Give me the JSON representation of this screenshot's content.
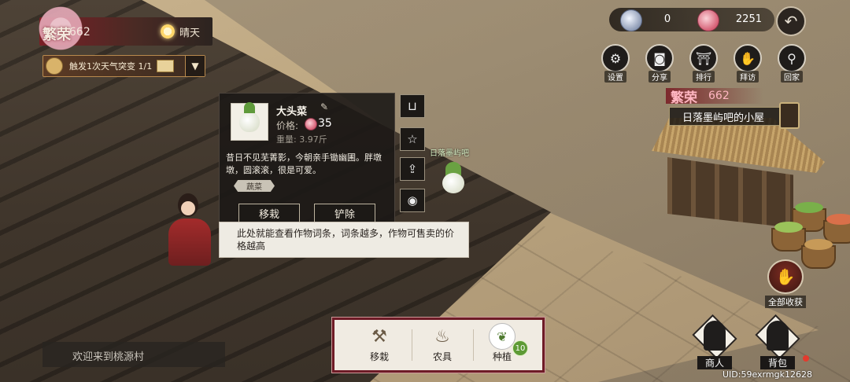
{
  "status": {
    "prosperity_label": "繁荣",
    "prosperity_value": "662",
    "weather": "晴天",
    "event_text": "触发1次天气突变 1/1"
  },
  "currency": {
    "silver": "0",
    "jade": "2251"
  },
  "menu": [
    {
      "label": "设置",
      "icon": "gear-icon"
    },
    {
      "label": "分享",
      "icon": "camera-icon"
    },
    {
      "label": "排行",
      "icon": "gate-icon"
    },
    {
      "label": "拜访",
      "icon": "handshake-icon"
    },
    {
      "label": "回家",
      "icon": "location-pin-icon"
    }
  ],
  "house": {
    "prosperity_label": "繁荣",
    "prosperity_value": "662",
    "name": "日落墨屿吧的小屋"
  },
  "item_card": {
    "name": "大头菜",
    "price_label": "价格:",
    "price": "35",
    "weight": "重量: 3.97斤",
    "description": "昔日不见芜菁影，今朝亲手锄幽圃。胖墩墩，圆滚滚，很是可爱。",
    "tag": "蔬菜",
    "action_transplant": "移栽",
    "action_remove": "铲除"
  },
  "plot_owner_label": "日落墨屿吧",
  "tip_text": "此处就能查看作物词条，词条越多，作物可售卖的价格越高",
  "toolbar": {
    "transplant": "移栽",
    "tools": "农具",
    "plant": "种植",
    "plant_count": "10"
  },
  "chat_placeholder": "欢迎来到桃源村",
  "harvest_all": "全部收获",
  "merchant": "商人",
  "backpack": "背包",
  "uid": "UID:59exrmgk12628"
}
